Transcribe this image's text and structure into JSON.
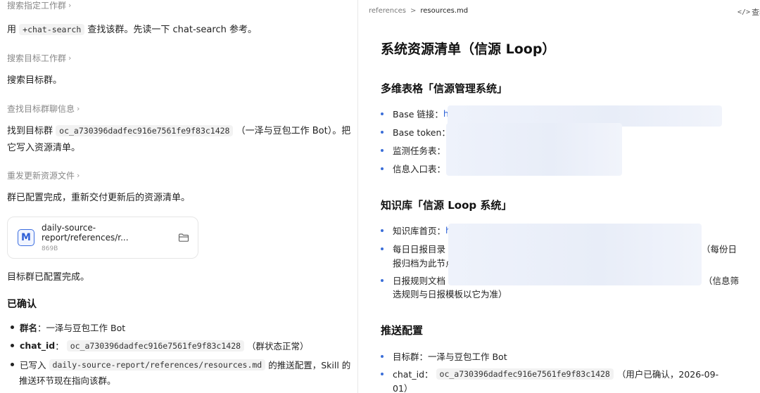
{
  "left": {
    "top_step": "搜索指定工作群",
    "p1_before": "用",
    "p1_code": "+chat-search",
    "p1_after": "查找该群。先读一下 chat-search 参考。",
    "step2": "搜索目标工作群",
    "p2": "搜索目标群。",
    "step3": "查找目标群聊信息",
    "p3_before": "找到目标群",
    "p3_code": "oc_a730396dadfec916e7561fe9f83c1428",
    "p3_after": "（一泽与豆包工作 Bot）。把",
    "p3_line2": "它写入资源清单。",
    "step4": "重发更新资源文件",
    "p4": "群已配置完成，重新交付更新后的资源清单。",
    "file": {
      "icon_letter": "M",
      "name": "daily-source-report/references/r...",
      "size": "869B"
    },
    "p5": "目标群已配置完成。",
    "h_confirmed": "已确认",
    "b1_label": "群名",
    "b1_value": "：一泽与豆包工作 Bot",
    "b2_label": "chat_id",
    "b2_sep": "：",
    "b2_code": "oc_a730396dadfec916e7561fe9f83c1428",
    "b2_after": "（群状态正常）",
    "b3_before": "已写入",
    "b3_code": "daily-source-report/references/resources.md",
    "b3_after": "的推送配置，Skill 的",
    "b3_line2": "推送环节现在指向该群。"
  },
  "right": {
    "crumb_parent": "references",
    "crumb_sep": ">",
    "crumb_current": "resources.md",
    "view_source": "查看",
    "title": "系统资源清单（信源 Loop）",
    "sec1": "多维表格「信源管理系统」",
    "s1_items": [
      "Base 链接：",
      "Base token：",
      "监测任务表：",
      "信息入口表："
    ],
    "s1_link_char": "h",
    "sec2": "知识库「信源 Loop 系统」",
    "s2_i1": "知识库首页：",
    "s2_link_char": "h",
    "s2_i2": "每日日报目录",
    "s2_i2_tail": "（每份日",
    "s2_i2_line2": "报归档为此节点",
    "s2_i3": "日报规则文档",
    "s2_i3_tail": "（信息筛",
    "s2_i3_line2": "选规则与日报模板以它为准）",
    "sec3": "推送配置",
    "s3_i1": "目标群：一泽与豆包工作 Bot",
    "s3_i2_label": "chat_id：",
    "s3_i2_code": "oc_a730396dadfec916e7561fe9f83c1428",
    "s3_i2_after": "（用户已确认，2026-09-",
    "s3_i2_line2": "01）"
  }
}
